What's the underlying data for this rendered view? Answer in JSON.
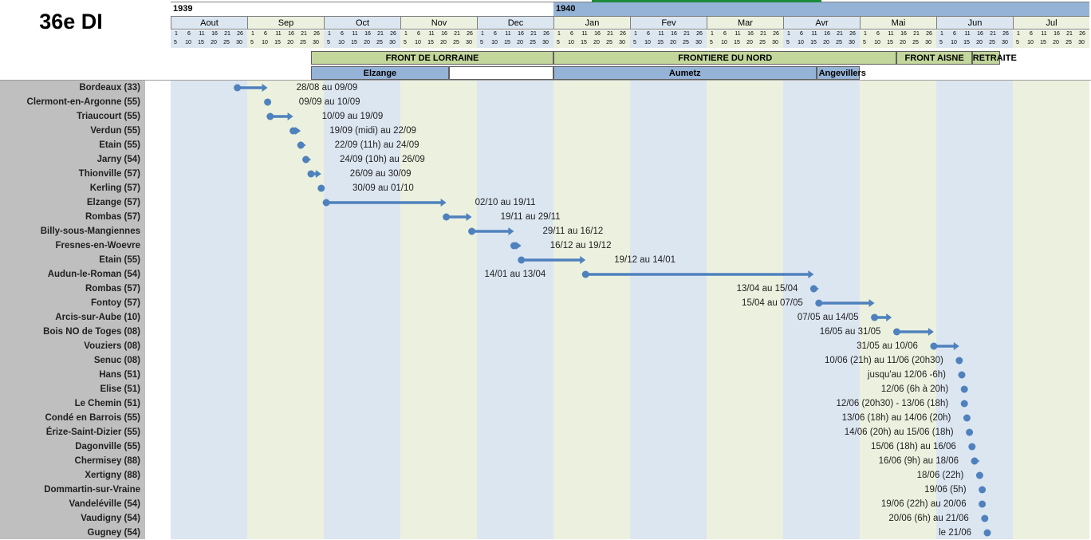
{
  "sheet": {
    "title": "36e DI"
  },
  "colors": {
    "bar": "#4f81bd",
    "greenPhase": "#c3d69b",
    "bluePhase": "#95b3d7",
    "lightBlue": "#dce6f1",
    "lightGreen": "#ebf1de",
    "labelCol": "#bfbfbf"
  },
  "chart_data": {
    "type": "gantt",
    "years": [
      {
        "label": "1939",
        "start": "1939-08-01"
      },
      {
        "label": "1940",
        "start": "1940-01-01"
      }
    ],
    "months": [
      "Aout",
      "Sep",
      "Oct",
      "Nov",
      "Dec",
      "Jan",
      "Fev",
      "Mar",
      "Avr",
      "Mai",
      "Jun",
      "Jul"
    ],
    "day_ticks_top": [
      "1",
      "6",
      "11",
      "16",
      "21",
      "26"
    ],
    "day_ticks_bottom": [
      "5",
      "10",
      "15",
      "20",
      "25",
      "30"
    ],
    "phases": [
      {
        "label": "FRONT DE LORRAINE",
        "start": "1939-09-26",
        "end": "1940-01-01",
        "fill": "green"
      },
      {
        "label": "FRONTIERE DU NORD",
        "start": "1940-01-01",
        "end": "1940-05-16",
        "fill": "green"
      },
      {
        "label": "FRONT AISNE",
        "start": "1940-05-16",
        "end": "1940-06-15",
        "fill": "green"
      },
      {
        "label": "RETRAITE",
        "start": "1940-06-15",
        "end": "1940-06-26",
        "fill": "green"
      }
    ],
    "sectors": [
      {
        "label": "Elzange",
        "start": "1939-09-26",
        "end": "1939-11-20",
        "fill": "blue"
      },
      {
        "label": "",
        "start": "1939-11-20",
        "end": "1940-01-01",
        "fill": "white"
      },
      {
        "label": "Aumetz",
        "start": "1940-01-01",
        "end": "1940-04-14",
        "fill": "blue"
      },
      {
        "label": "Angevillers",
        "start": "1940-04-14",
        "end": "1940-05-01",
        "fill": "blue"
      }
    ],
    "rows": [
      {
        "place": "Bordeaux (33)",
        "start": "1939-08-28",
        "end": "1939-09-09",
        "label": "28/08 au 09/09"
      },
      {
        "place": "Clermont-en-Argonne (55)",
        "start": "1939-09-09",
        "end": "1939-09-10",
        "label": "09/09 au 10/09"
      },
      {
        "place": "Triaucourt (55)",
        "start": "1939-09-10",
        "end": "1939-09-19",
        "label": "10/09 au 19/09"
      },
      {
        "place": "Verdun (55)",
        "start": "1939-09-19",
        "end": "1939-09-22",
        "label": "19/09 (midi) au 22/09"
      },
      {
        "place": "Etain (55)",
        "start": "1939-09-22",
        "end": "1939-09-24",
        "label": "22/09 (11h) au 24/09"
      },
      {
        "place": "Jarny (54)",
        "start": "1939-09-24",
        "end": "1939-09-26",
        "label": "24/09 (10h) au 26/09"
      },
      {
        "place": "Thionville (57)",
        "start": "1939-09-26",
        "end": "1939-09-30",
        "label": "26/09 au 30/09"
      },
      {
        "place": "Kerling (57)",
        "start": "1939-09-30",
        "end": "1939-10-01",
        "label": "30/09 au 01/10"
      },
      {
        "place": "Elzange (57)",
        "start": "1939-10-02",
        "end": "1939-11-19",
        "label": "02/10 au 19/11"
      },
      {
        "place": "Rombas (57)",
        "start": "1939-11-19",
        "end": "1939-11-29",
        "label": "19/11 au 29/11"
      },
      {
        "place": "Billy-sous-Mangiennes",
        "start": "1939-11-29",
        "end": "1939-12-16",
        "label": "29/11 au 16/12"
      },
      {
        "place": "Fresnes-en-Woevre",
        "start": "1939-12-16",
        "end": "1939-12-19",
        "label": "16/12 au 19/12"
      },
      {
        "place": "Etain (55)",
        "start": "1939-12-19",
        "end": "1940-01-14",
        "label": "19/12 au 14/01"
      },
      {
        "place": "Audun-le-Roman (54)",
        "start": "1940-01-14",
        "end": "1940-04-13",
        "label": "14/01 au 13/04"
      },
      {
        "place": "Rombas (57)",
        "start": "1940-04-13",
        "end": "1940-04-15",
        "label": "13/04 au 15/04"
      },
      {
        "place": "Fontoy (57)",
        "start": "1940-04-15",
        "end": "1940-05-07",
        "label": "15/04 au 07/05"
      },
      {
        "place": "Arcis-sur-Aube (10)",
        "start": "1940-05-07",
        "end": "1940-05-14",
        "label": "07/05 au 14/05"
      },
      {
        "place": "Bois NO de Toges (08)",
        "start": "1940-05-16",
        "end": "1940-05-31",
        "label": "16/05 au 31/05"
      },
      {
        "place": "Vouziers (08)",
        "start": "1940-05-31",
        "end": "1940-06-10",
        "label": "31/05 au 10/06"
      },
      {
        "place": "Senuc (08)",
        "start": "1940-06-10",
        "end": "1940-06-11",
        "label": "10/06 (21h) au 11/06 (20h30)"
      },
      {
        "place": "Hans (51)",
        "start": "1940-06-11",
        "end": "1940-06-12",
        "label": "jusqu'au 12/06 -6h)"
      },
      {
        "place": "Elise (51)",
        "start": "1940-06-12",
        "end": "1940-06-12",
        "label": "12/06 (6h à 20h)"
      },
      {
        "place": "Le Chemin (51)",
        "start": "1940-06-12",
        "end": "1940-06-13",
        "label": "12/06 (20h30) - 13/06 (18h)"
      },
      {
        "place": "Condé en Barrois (55)",
        "start": "1940-06-13",
        "end": "1940-06-14",
        "label": "13/06 (18h) au 14/06 (20h)"
      },
      {
        "place": "Érize-Saint-Dizier (55)",
        "start": "1940-06-14",
        "end": "1940-06-15",
        "label": "14/06 (20h) au 15/06 (18h)"
      },
      {
        "place": "Dagonville (55)",
        "start": "1940-06-15",
        "end": "1940-06-16",
        "label": "15/06 (18h) au 16/06"
      },
      {
        "place": "Chermisey (88)",
        "start": "1940-06-16",
        "end": "1940-06-18",
        "label": "16/06 (9h) au 18/06"
      },
      {
        "place": "Xertigny (88)",
        "start": "1940-06-18",
        "end": "1940-06-18",
        "label": "18/06 (22h)"
      },
      {
        "place": "Dommartin-sur-Vraine",
        "start": "1940-06-19",
        "end": "1940-06-19",
        "label": "19/06 (5h)"
      },
      {
        "place": "Vandeléville (54)",
        "start": "1940-06-19",
        "end": "1940-06-20",
        "label": "19/06 (22h) au 20/06"
      },
      {
        "place": "Vaudigny (54)",
        "start": "1940-06-20",
        "end": "1940-06-21",
        "label": "20/06 (6h) au 21/06"
      },
      {
        "place": "Gugney (54)",
        "start": "1940-06-21",
        "end": "1940-06-21",
        "label": "le 21/06"
      }
    ]
  }
}
